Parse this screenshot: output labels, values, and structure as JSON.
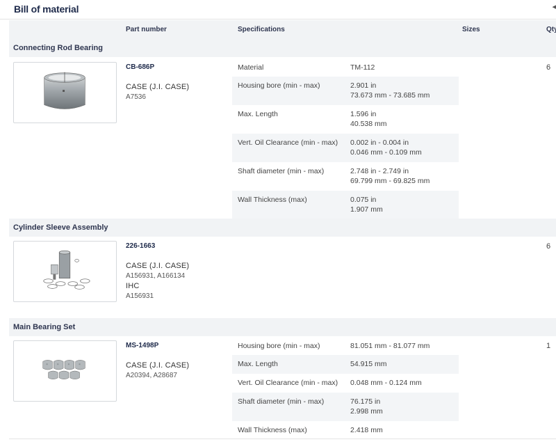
{
  "title": "Bill of material",
  "header": {
    "part_number": "Part number",
    "specifications": "Specifications",
    "sizes": "Sizes",
    "qty": "Qty"
  },
  "groups": [
    {
      "name": "Connecting Rod Bearing",
      "part_number": "CB-686P",
      "manufacturers": [
        {
          "name": "CASE (J.I. CASE)",
          "refs": "A7536"
        }
      ],
      "qty": "6",
      "specs": [
        {
          "label": "Material",
          "value": "TM-112"
        },
        {
          "label": "Housing bore (min - max)",
          "value": "2.901 in\n73.673 mm - 73.685 mm"
        },
        {
          "label": "Max. Length",
          "value": "1.596 in\n40.538 mm"
        },
        {
          "label": "Vert. Oil Clearance (min - max)",
          "value": "0.002 in - 0.004 in\n0.046 mm - 0.109 mm"
        },
        {
          "label": "Shaft diameter (min - max)",
          "value": "2.748 in - 2.749 in\n69.799 mm - 69.825 mm"
        },
        {
          "label": "Wall Thickness (max)",
          "value": "0.075 in\n1.907 mm"
        }
      ]
    },
    {
      "name": "Cylinder Sleeve Assembly",
      "part_number": "226-1663",
      "manufacturers": [
        {
          "name": "CASE (J.I. CASE)",
          "refs": "A156931, A166134"
        },
        {
          "name": "IHC",
          "refs": "A156931"
        }
      ],
      "qty": "6",
      "specs": []
    },
    {
      "name": "Main Bearing Set",
      "part_number": "MS-1498P",
      "manufacturers": [
        {
          "name": "CASE (J.I. CASE)",
          "refs": "A20394, A28687"
        }
      ],
      "qty": "1",
      "specs": [
        {
          "label": "Housing bore (min - max)",
          "value": "81.051 mm - 81.077 mm"
        },
        {
          "label": "Max. Length",
          "value": "54.915 mm"
        },
        {
          "label": "Vert. Oil Clearance (min - max)",
          "value": "0.048 mm - 0.124 mm"
        },
        {
          "label": "Shaft diameter (min - max)",
          "value": "76.175 in\n2.998 mm"
        },
        {
          "label": "Wall Thickness (max)",
          "value": "2.418 mm"
        }
      ]
    }
  ]
}
